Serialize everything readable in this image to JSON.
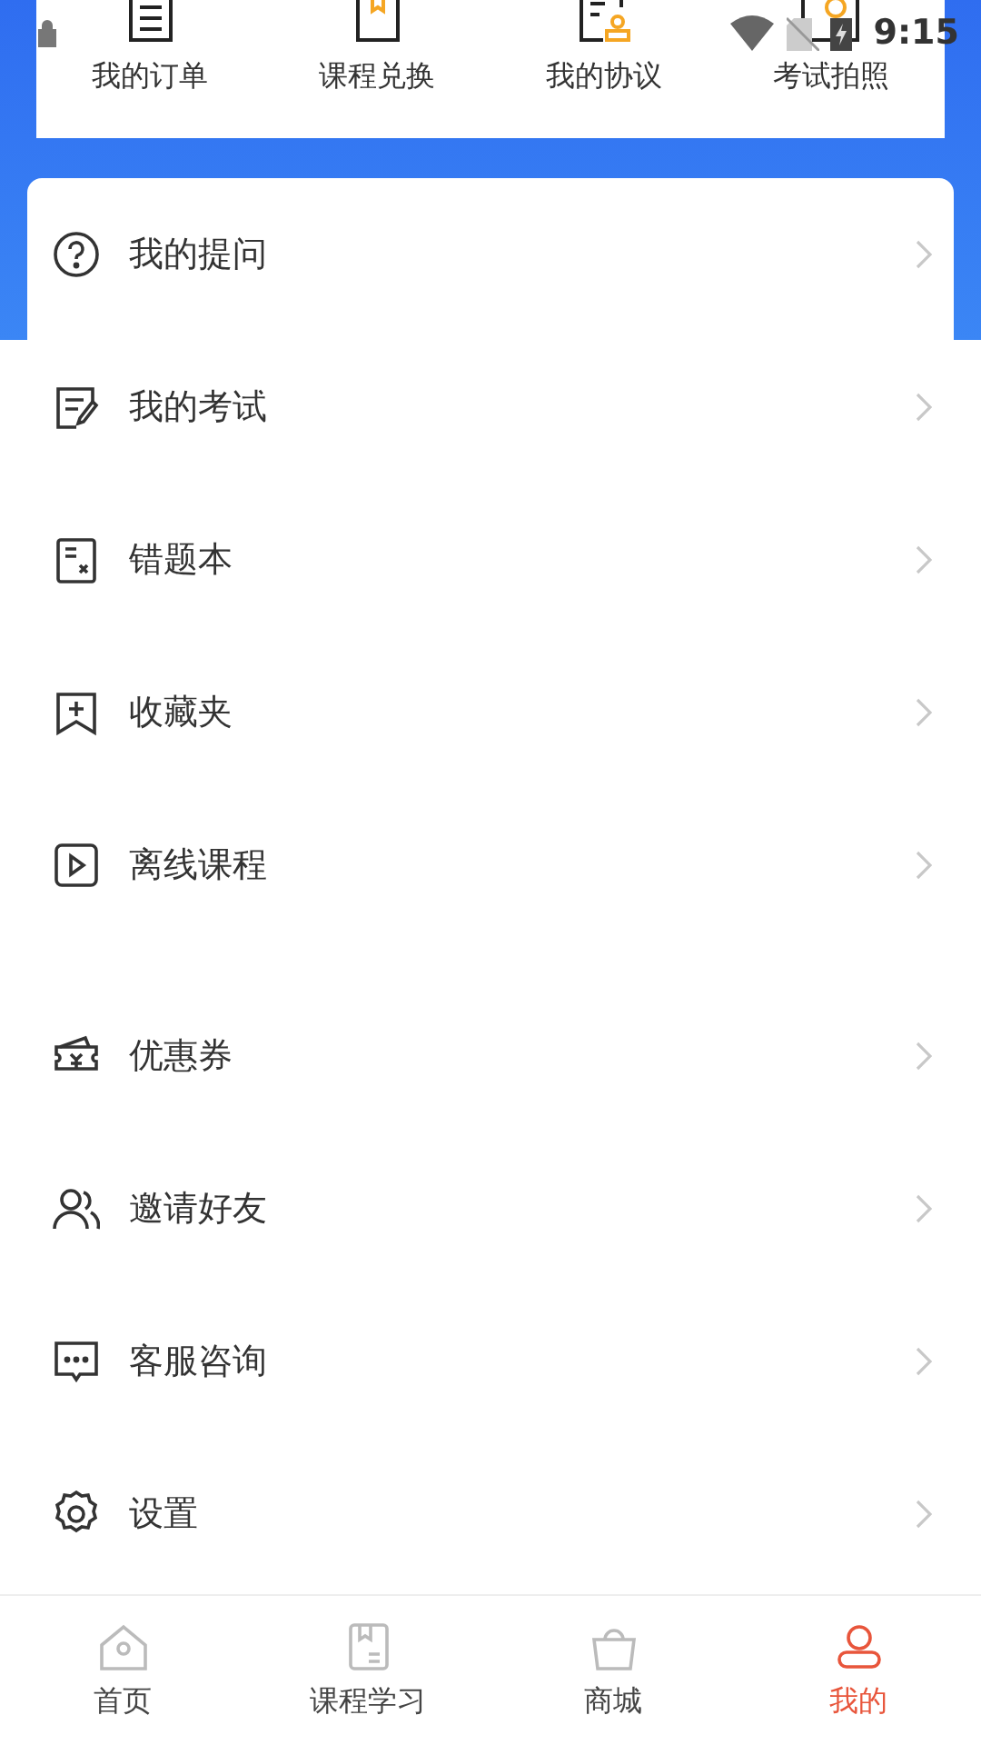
{
  "status_bar": {
    "time": "9:15"
  },
  "shortcuts": [
    {
      "label": "我的订单"
    },
    {
      "label": "课程兑换"
    },
    {
      "label": "我的协议"
    },
    {
      "label": "考试拍照"
    }
  ],
  "menu_groups": [
    {
      "items": [
        {
          "label": "我的提问"
        },
        {
          "label": "我的考试"
        },
        {
          "label": "错题本"
        },
        {
          "label": "收藏夹"
        },
        {
          "label": "离线课程"
        }
      ]
    },
    {
      "items": [
        {
          "label": "优惠券"
        },
        {
          "label": "邀请好友"
        },
        {
          "label": "客服咨询"
        },
        {
          "label": "设置"
        }
      ]
    }
  ],
  "bottom_nav": [
    {
      "label": "首页",
      "selected": false
    },
    {
      "label": "课程学习",
      "selected": false
    },
    {
      "label": "商城",
      "selected": false
    },
    {
      "label": "我的",
      "selected": true
    }
  ]
}
